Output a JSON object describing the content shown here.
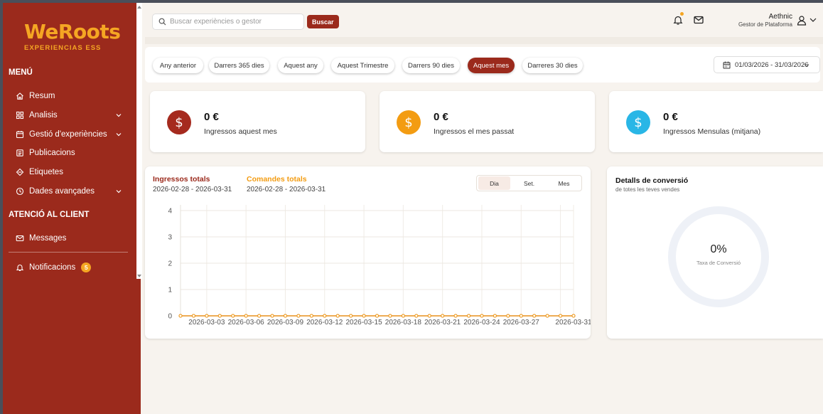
{
  "brand": {
    "logo_text": "WeRoots",
    "logo_sub": "EXPERIENCIAS ESS"
  },
  "sidebar": {
    "menu_heading": "MENÚ",
    "items": [
      {
        "label": "Resum",
        "icon": "home-icon"
      },
      {
        "label": "Analisis",
        "icon": "grid-icon",
        "expandable": true
      },
      {
        "label": "Gestió d'experiències",
        "icon": "calendar-icon",
        "expandable": true
      },
      {
        "label": "Publicacions",
        "icon": "list-icon"
      },
      {
        "label": "Etiquetes",
        "icon": "tag-icon"
      },
      {
        "label": "Dades avançades",
        "icon": "clock-icon",
        "expandable": true
      }
    ],
    "support_heading": "ATENCIÓ AL CLIENT",
    "messages_label": "Messages",
    "notifications_label": "Notificacions",
    "notifications_count": "5"
  },
  "header": {
    "search_placeholder": "Buscar experiències o gestor",
    "search_button": "Buscar",
    "user_name": "Aethnic",
    "user_role": "Gestor de Plataforma"
  },
  "filters": {
    "pills": [
      "Any anterior",
      "Darrers 365 dies",
      "Aquest any",
      "Aquest Trimestre",
      "Darrers 90 dies",
      "Aquest mes",
      "Darreres 30 dies"
    ],
    "active_index": 5,
    "date_range": "01/03/2026 - 31/03/2026"
  },
  "stats": [
    {
      "value": "0 €",
      "label": "Ingressos aquest mes",
      "color": "#a52a1e"
    },
    {
      "value": "0 €",
      "label": "Ingressos el mes passat",
      "color": "#f39c12"
    },
    {
      "value": "0 €",
      "label": "Ingressos Mensulas (mitjana)",
      "color": "#29b6e6"
    }
  ],
  "chart_panel": {
    "series_1_title": "Ingressos totals",
    "series_1_range": "2026-02-28 - 2026-03-31",
    "series_2_title": "Comandes totals",
    "series_2_range": "2026-02-28 - 2026-03-31",
    "granularity": [
      "Dia",
      "Set.",
      "Mes"
    ],
    "granularity_active": 0
  },
  "chart_data": {
    "type": "line",
    "x": [
      "2026-03-01",
      "2026-03-02",
      "2026-03-03",
      "2026-03-04",
      "2026-03-05",
      "2026-03-06",
      "2026-03-07",
      "2026-03-08",
      "2026-03-09",
      "2026-03-10",
      "2026-03-11",
      "2026-03-12",
      "2026-03-13",
      "2026-03-14",
      "2026-03-15",
      "2026-03-16",
      "2026-03-17",
      "2026-03-18",
      "2026-03-19",
      "2026-03-20",
      "2026-03-21",
      "2026-03-22",
      "2026-03-23",
      "2026-03-24",
      "2026-03-25",
      "2026-03-26",
      "2026-03-27",
      "2026-03-28",
      "2026-03-29",
      "2026-03-30",
      "2026-03-31"
    ],
    "x_tick_labels": [
      "2026-03-03",
      "2026-03-06",
      "2026-03-09",
      "2026-03-12",
      "2026-03-15",
      "2026-03-18",
      "2026-03-21",
      "2026-03-24",
      "2026-03-27",
      "2026-03-31"
    ],
    "y_ticks": [
      0,
      1,
      2,
      3,
      4
    ],
    "ylim": [
      0,
      4
    ],
    "series": [
      {
        "name": "Ingressos totals",
        "color": "#9b2a1c",
        "values": [
          0,
          0,
          0,
          0,
          0,
          0,
          0,
          0,
          0,
          0,
          0,
          0,
          0,
          0,
          0,
          0,
          0,
          0,
          0,
          0,
          0,
          0,
          0,
          0,
          0,
          0,
          0,
          0,
          0,
          0,
          0
        ]
      },
      {
        "name": "Comandes totals",
        "color": "#f39c12",
        "values": [
          0,
          0,
          0,
          0,
          0,
          0,
          0,
          0,
          0,
          0,
          0,
          0,
          0,
          0,
          0,
          0,
          0,
          0,
          0,
          0,
          0,
          0,
          0,
          0,
          0,
          0,
          0,
          0,
          0,
          0,
          0
        ]
      }
    ],
    "grid": true
  },
  "conversion": {
    "title": "Detalls de conversió",
    "subtitle": "de totes les teves vendes",
    "value": "0%",
    "label": "Taxa de Conversió"
  }
}
